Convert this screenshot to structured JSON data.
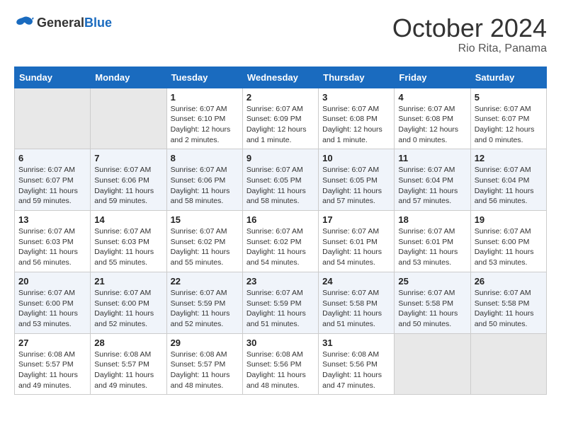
{
  "logo": {
    "general": "General",
    "blue": "Blue"
  },
  "title": "October 2024",
  "location": "Rio Rita, Panama",
  "days_header": [
    "Sunday",
    "Monday",
    "Tuesday",
    "Wednesday",
    "Thursday",
    "Friday",
    "Saturday"
  ],
  "weeks": [
    [
      {
        "day": "",
        "detail": ""
      },
      {
        "day": "",
        "detail": ""
      },
      {
        "day": "1",
        "detail": "Sunrise: 6:07 AM\nSunset: 6:10 PM\nDaylight: 12 hours\nand 2 minutes."
      },
      {
        "day": "2",
        "detail": "Sunrise: 6:07 AM\nSunset: 6:09 PM\nDaylight: 12 hours\nand 1 minute."
      },
      {
        "day": "3",
        "detail": "Sunrise: 6:07 AM\nSunset: 6:08 PM\nDaylight: 12 hours\nand 1 minute."
      },
      {
        "day": "4",
        "detail": "Sunrise: 6:07 AM\nSunset: 6:08 PM\nDaylight: 12 hours\nand 0 minutes."
      },
      {
        "day": "5",
        "detail": "Sunrise: 6:07 AM\nSunset: 6:07 PM\nDaylight: 12 hours\nand 0 minutes."
      }
    ],
    [
      {
        "day": "6",
        "detail": "Sunrise: 6:07 AM\nSunset: 6:07 PM\nDaylight: 11 hours\nand 59 minutes."
      },
      {
        "day": "7",
        "detail": "Sunrise: 6:07 AM\nSunset: 6:06 PM\nDaylight: 11 hours\nand 59 minutes."
      },
      {
        "day": "8",
        "detail": "Sunrise: 6:07 AM\nSunset: 6:06 PM\nDaylight: 11 hours\nand 58 minutes."
      },
      {
        "day": "9",
        "detail": "Sunrise: 6:07 AM\nSunset: 6:05 PM\nDaylight: 11 hours\nand 58 minutes."
      },
      {
        "day": "10",
        "detail": "Sunrise: 6:07 AM\nSunset: 6:05 PM\nDaylight: 11 hours\nand 57 minutes."
      },
      {
        "day": "11",
        "detail": "Sunrise: 6:07 AM\nSunset: 6:04 PM\nDaylight: 11 hours\nand 57 minutes."
      },
      {
        "day": "12",
        "detail": "Sunrise: 6:07 AM\nSunset: 6:04 PM\nDaylight: 11 hours\nand 56 minutes."
      }
    ],
    [
      {
        "day": "13",
        "detail": "Sunrise: 6:07 AM\nSunset: 6:03 PM\nDaylight: 11 hours\nand 56 minutes."
      },
      {
        "day": "14",
        "detail": "Sunrise: 6:07 AM\nSunset: 6:03 PM\nDaylight: 11 hours\nand 55 minutes."
      },
      {
        "day": "15",
        "detail": "Sunrise: 6:07 AM\nSunset: 6:02 PM\nDaylight: 11 hours\nand 55 minutes."
      },
      {
        "day": "16",
        "detail": "Sunrise: 6:07 AM\nSunset: 6:02 PM\nDaylight: 11 hours\nand 54 minutes."
      },
      {
        "day": "17",
        "detail": "Sunrise: 6:07 AM\nSunset: 6:01 PM\nDaylight: 11 hours\nand 54 minutes."
      },
      {
        "day": "18",
        "detail": "Sunrise: 6:07 AM\nSunset: 6:01 PM\nDaylight: 11 hours\nand 53 minutes."
      },
      {
        "day": "19",
        "detail": "Sunrise: 6:07 AM\nSunset: 6:00 PM\nDaylight: 11 hours\nand 53 minutes."
      }
    ],
    [
      {
        "day": "20",
        "detail": "Sunrise: 6:07 AM\nSunset: 6:00 PM\nDaylight: 11 hours\nand 53 minutes."
      },
      {
        "day": "21",
        "detail": "Sunrise: 6:07 AM\nSunset: 6:00 PM\nDaylight: 11 hours\nand 52 minutes."
      },
      {
        "day": "22",
        "detail": "Sunrise: 6:07 AM\nSunset: 5:59 PM\nDaylight: 11 hours\nand 52 minutes."
      },
      {
        "day": "23",
        "detail": "Sunrise: 6:07 AM\nSunset: 5:59 PM\nDaylight: 11 hours\nand 51 minutes."
      },
      {
        "day": "24",
        "detail": "Sunrise: 6:07 AM\nSunset: 5:58 PM\nDaylight: 11 hours\nand 51 minutes."
      },
      {
        "day": "25",
        "detail": "Sunrise: 6:07 AM\nSunset: 5:58 PM\nDaylight: 11 hours\nand 50 minutes."
      },
      {
        "day": "26",
        "detail": "Sunrise: 6:07 AM\nSunset: 5:58 PM\nDaylight: 11 hours\nand 50 minutes."
      }
    ],
    [
      {
        "day": "27",
        "detail": "Sunrise: 6:08 AM\nSunset: 5:57 PM\nDaylight: 11 hours\nand 49 minutes."
      },
      {
        "day": "28",
        "detail": "Sunrise: 6:08 AM\nSunset: 5:57 PM\nDaylight: 11 hours\nand 49 minutes."
      },
      {
        "day": "29",
        "detail": "Sunrise: 6:08 AM\nSunset: 5:57 PM\nDaylight: 11 hours\nand 48 minutes."
      },
      {
        "day": "30",
        "detail": "Sunrise: 6:08 AM\nSunset: 5:56 PM\nDaylight: 11 hours\nand 48 minutes."
      },
      {
        "day": "31",
        "detail": "Sunrise: 6:08 AM\nSunset: 5:56 PM\nDaylight: 11 hours\nand 47 minutes."
      },
      {
        "day": "",
        "detail": ""
      },
      {
        "day": "",
        "detail": ""
      }
    ]
  ]
}
